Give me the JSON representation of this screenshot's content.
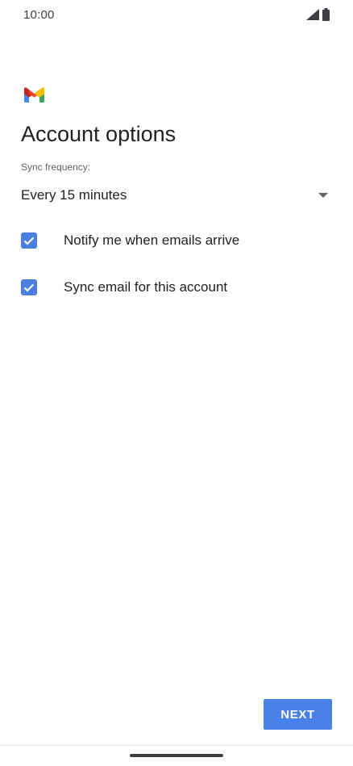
{
  "status_bar": {
    "time": "10:00",
    "signal_icon": "cellular-signal-icon",
    "battery_icon": "battery-icon"
  },
  "app": {
    "logo_icon": "gmail-logo-icon"
  },
  "page": {
    "title": "Account options"
  },
  "sync": {
    "label": "Sync frequency:",
    "selected_value": "Every 15 minutes",
    "dropdown_icon": "dropdown-arrow-icon"
  },
  "options": [
    {
      "label": "Notify me when emails arrive",
      "checked": true
    },
    {
      "label": "Sync email for this account",
      "checked": true
    }
  ],
  "actions": {
    "next_label": "NEXT"
  },
  "colors": {
    "accent": "#4a81e8",
    "checkbox": "#4a7fe0",
    "text_primary": "#202124",
    "text_secondary": "#5f6368"
  }
}
